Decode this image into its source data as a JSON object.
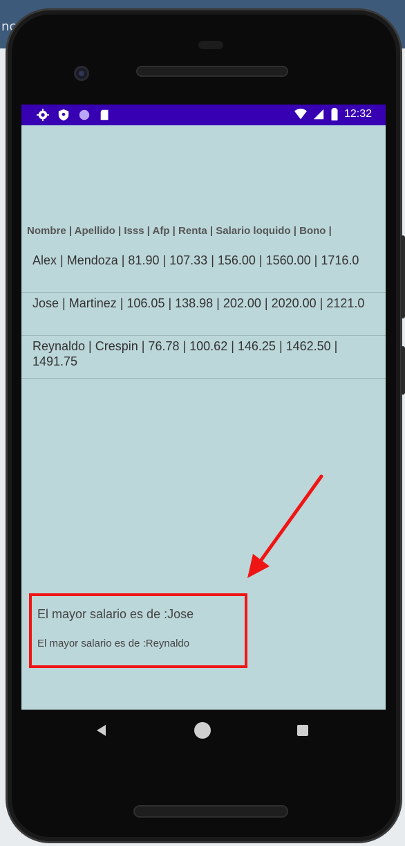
{
  "window_bg_text": "nc",
  "status_bar": {
    "time": "12:32",
    "icons_left": [
      "gear-icon",
      "shield-icon",
      "circle-icon",
      "sd-card-icon"
    ],
    "icons_right": [
      "wifi-icon",
      "signal-icon",
      "battery-icon"
    ]
  },
  "table": {
    "header": "Nombre | Apellido | Isss | Afp | Renta | Salario loquido | Bono |",
    "rows": [
      "Alex | Mendoza | 81.90 | 107.33 | 156.00 | 1560.00 | 1716.0",
      "Jose | Martinez | 106.05 | 138.98 | 202.00 | 2020.00 | 2121.0",
      "Reynaldo | Crespin | 76.78 | 100.62 | 146.25 | 1462.50 | 1491.75"
    ]
  },
  "results": {
    "line1": "El mayor salario es de :Jose",
    "line2": "El mayor salario es de :Reynaldo"
  },
  "colors": {
    "status_bar": "#3700b3",
    "screen_bg": "#bcd7da",
    "highlight_box": "#f01515"
  }
}
